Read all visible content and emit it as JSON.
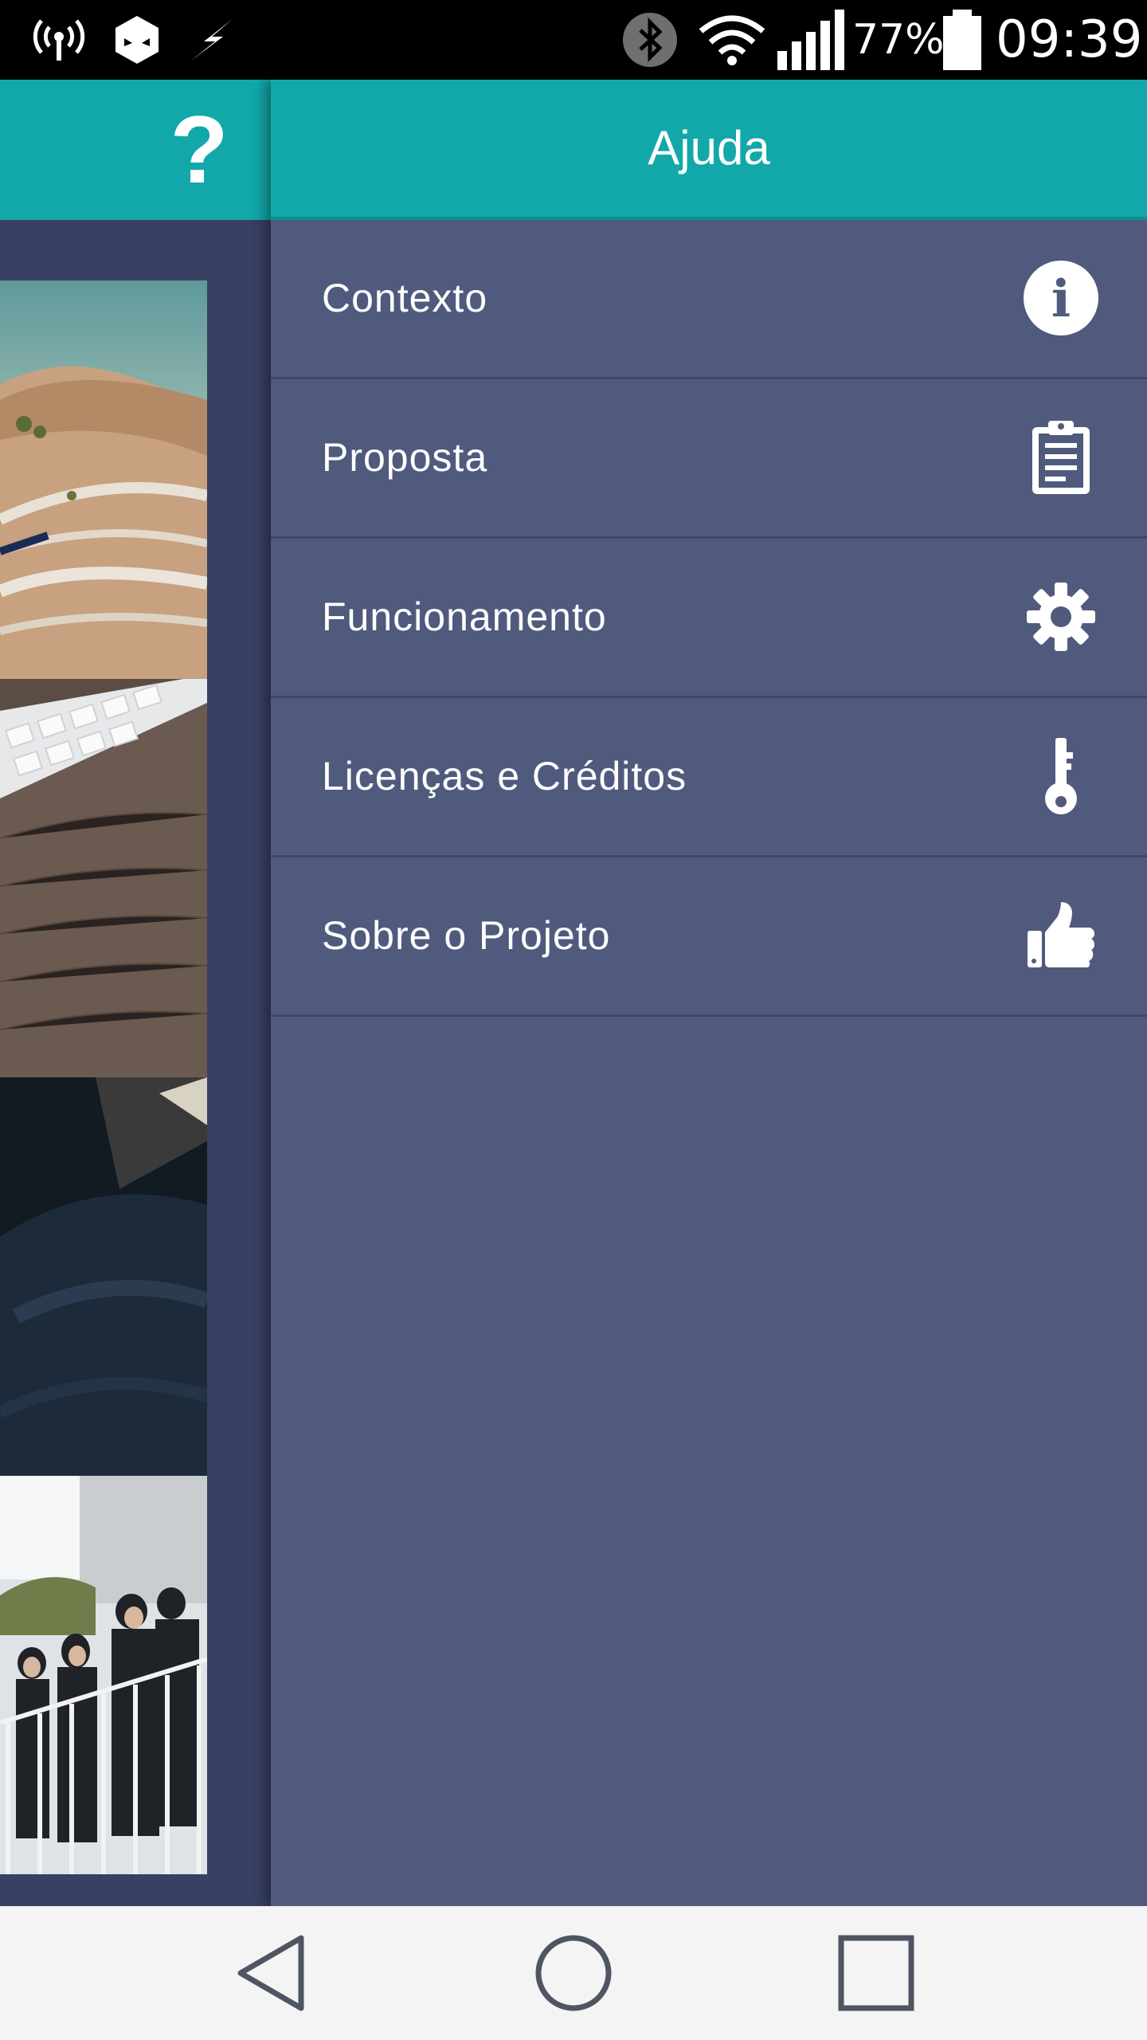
{
  "status_bar": {
    "battery_percent": "77%",
    "time": "09:39",
    "icons": [
      "wireless-hotspot-icon",
      "app-notification-icon",
      "charging-bolt-icon",
      "bluetooth-icon",
      "wifi-icon",
      "cellular-signal-icon",
      "battery-icon"
    ]
  },
  "background_app": {
    "help_symbol": "?",
    "thumbnails": [
      "landscape-highway-photo",
      "keyboard-desk-photo",
      "dark-photo",
      "students-group-photo"
    ]
  },
  "drawer": {
    "title": "Ajuda",
    "items": [
      {
        "label": "Contexto",
        "icon": "info-icon"
      },
      {
        "label": "Proposta",
        "icon": "clipboard-icon"
      },
      {
        "label": "Funcionamento",
        "icon": "gear-icon"
      },
      {
        "label": "Licenças e Créditos",
        "icon": "key-icon"
      },
      {
        "label": "Sobre o Projeto",
        "icon": "thumbs-up-icon"
      }
    ]
  },
  "nav_bar": {
    "buttons": [
      "back-icon",
      "home-icon",
      "recents-icon"
    ]
  },
  "colors": {
    "header_teal": "#12a8a9",
    "drawer_bg": "#505a7d",
    "panel_bg": "#384063",
    "nav_bg": "#f4f4f4"
  }
}
